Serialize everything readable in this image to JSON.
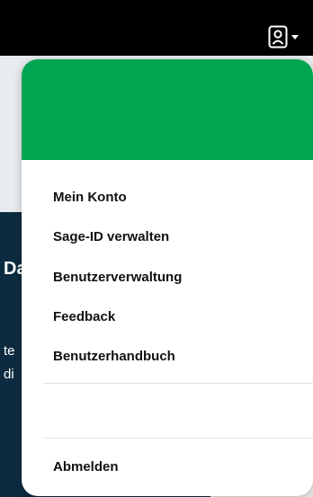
{
  "colors": {
    "topbar": "#000000",
    "menu_header": "#00a551",
    "page_background": "#e9ecee",
    "dark_panel": "#0d2b40"
  },
  "topbar": {
    "user_icon": "user-icon",
    "caret_icon": "chevron-down-icon"
  },
  "background_fragments": {
    "heading_fragment": "Da",
    "line1_fragment": "te",
    "line2_fragment": "di"
  },
  "menu": {
    "items": [
      {
        "label": "Mein Konto"
      },
      {
        "label": "Sage-ID verwalten"
      },
      {
        "label": "Benutzerverwaltung"
      },
      {
        "label": "Feedback"
      },
      {
        "label": "Benutzerhandbuch"
      }
    ],
    "logout_label": "Abmelden"
  }
}
